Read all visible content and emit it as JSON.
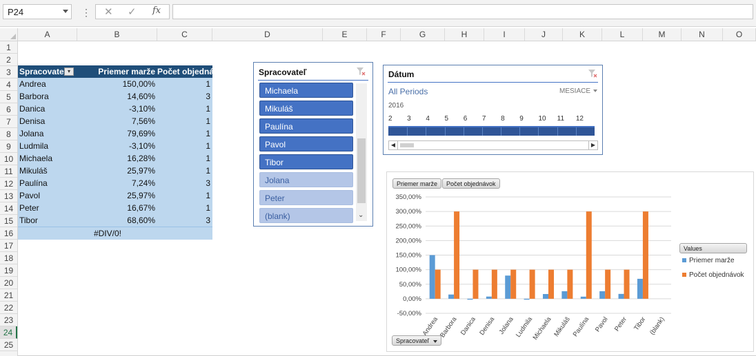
{
  "formula_bar": {
    "name_box": "P24",
    "cancel_icon": "✕",
    "enter_icon": "✓",
    "fx_label": "fx",
    "formula": ""
  },
  "columns": [
    {
      "label": "A",
      "w": 86
    },
    {
      "label": "B",
      "w": 116
    },
    {
      "label": "C",
      "w": 80
    },
    {
      "label": "D",
      "w": 160
    },
    {
      "label": "E",
      "w": 64
    },
    {
      "label": "F",
      "w": 49
    },
    {
      "label": "G",
      "w": 64
    },
    {
      "label": "H",
      "w": 57
    },
    {
      "label": "I",
      "w": 59
    },
    {
      "label": "J",
      "w": 55
    },
    {
      "label": "K",
      "w": 57
    },
    {
      "label": "L",
      "w": 59
    },
    {
      "label": "M",
      "w": 56
    },
    {
      "label": "N",
      "w": 60
    },
    {
      "label": "O",
      "w": 48
    }
  ],
  "rows": [
    "1",
    "2",
    "3",
    "4",
    "5",
    "6",
    "7",
    "8",
    "9",
    "10",
    "11",
    "12",
    "13",
    "14",
    "15",
    "16",
    "17",
    "18",
    "19",
    "20",
    "21",
    "22",
    "23",
    "24",
    "25"
  ],
  "selected_row": "24",
  "pivot": {
    "headers": [
      "Spracovateľ",
      "Priemer marže",
      "Počet objednávok"
    ],
    "rows": [
      [
        "Andrea",
        "150,00%",
        "1"
      ],
      [
        "Barbora",
        "14,60%",
        "3"
      ],
      [
        "Danica",
        "-3,10%",
        "1"
      ],
      [
        "Denisa",
        "7,56%",
        "1"
      ],
      [
        "Jolana",
        "79,69%",
        "1"
      ],
      [
        "Ludmila",
        "-3,10%",
        "1"
      ],
      [
        "Michaela",
        "16,28%",
        "1"
      ],
      [
        "Mikuláš",
        "25,97%",
        "1"
      ],
      [
        "Paulína",
        "7,24%",
        "3"
      ],
      [
        "Pavol",
        "25,97%",
        "1"
      ],
      [
        "Peter",
        "16,67%",
        "1"
      ],
      [
        "Tibor",
        "68,60%",
        "3"
      ]
    ],
    "total": [
      "",
      "#DIV/0!",
      ""
    ]
  },
  "slicer": {
    "title": "Spracovateľ",
    "items": [
      {
        "label": "Michaela",
        "selected": true
      },
      {
        "label": "Mikuláš",
        "selected": true
      },
      {
        "label": "Paulína",
        "selected": true
      },
      {
        "label": "Pavol",
        "selected": true
      },
      {
        "label": "Tibor",
        "selected": true
      },
      {
        "label": "Jolana",
        "selected": false
      },
      {
        "label": "Peter",
        "selected": false
      },
      {
        "label": "(blank)",
        "selected": false
      }
    ]
  },
  "timeline": {
    "title": "Dátum",
    "periods_label": "All Periods",
    "level_label": "MESIACE",
    "year": "2016",
    "months": [
      "2",
      "3",
      "4",
      "5",
      "6",
      "7",
      "8",
      "9",
      "10",
      "11",
      "12"
    ]
  },
  "chart": {
    "field_buttons": {
      "value1": "Priemer marže",
      "value2": "Počet objednávok",
      "axis": "Spracovateľ",
      "legend_title": "Values"
    },
    "colors": {
      "series1": "#5b9bd5",
      "series2": "#ed7d31"
    }
  },
  "chart_data": {
    "type": "bar",
    "categories": [
      "Andrea",
      "Barbora",
      "Danica",
      "Denisa",
      "Jolana",
      "Ludmila",
      "Michaela",
      "Mikuláš",
      "Paulína",
      "Pavol",
      "Peter",
      "Tibor",
      "(blank)"
    ],
    "series": [
      {
        "name": "Priemer marže",
        "values": [
          150.0,
          14.6,
          -3.1,
          7.56,
          79.69,
          -3.1,
          16.28,
          25.97,
          7.24,
          25.97,
          16.67,
          68.6,
          0
        ]
      },
      {
        "name": "Počet objednávok",
        "values": [
          100,
          300,
          100,
          100,
          100,
          100,
          100,
          100,
          300,
          100,
          100,
          300,
          0
        ]
      }
    ],
    "y_ticks": [
      "350,00%",
      "300,00%",
      "250,00%",
      "200,00%",
      "150,00%",
      "100,00%",
      "50,00%",
      "0,00%",
      "-50,00%"
    ],
    "ylim": [
      -50,
      350
    ],
    "grid": true,
    "legend_position": "right"
  }
}
